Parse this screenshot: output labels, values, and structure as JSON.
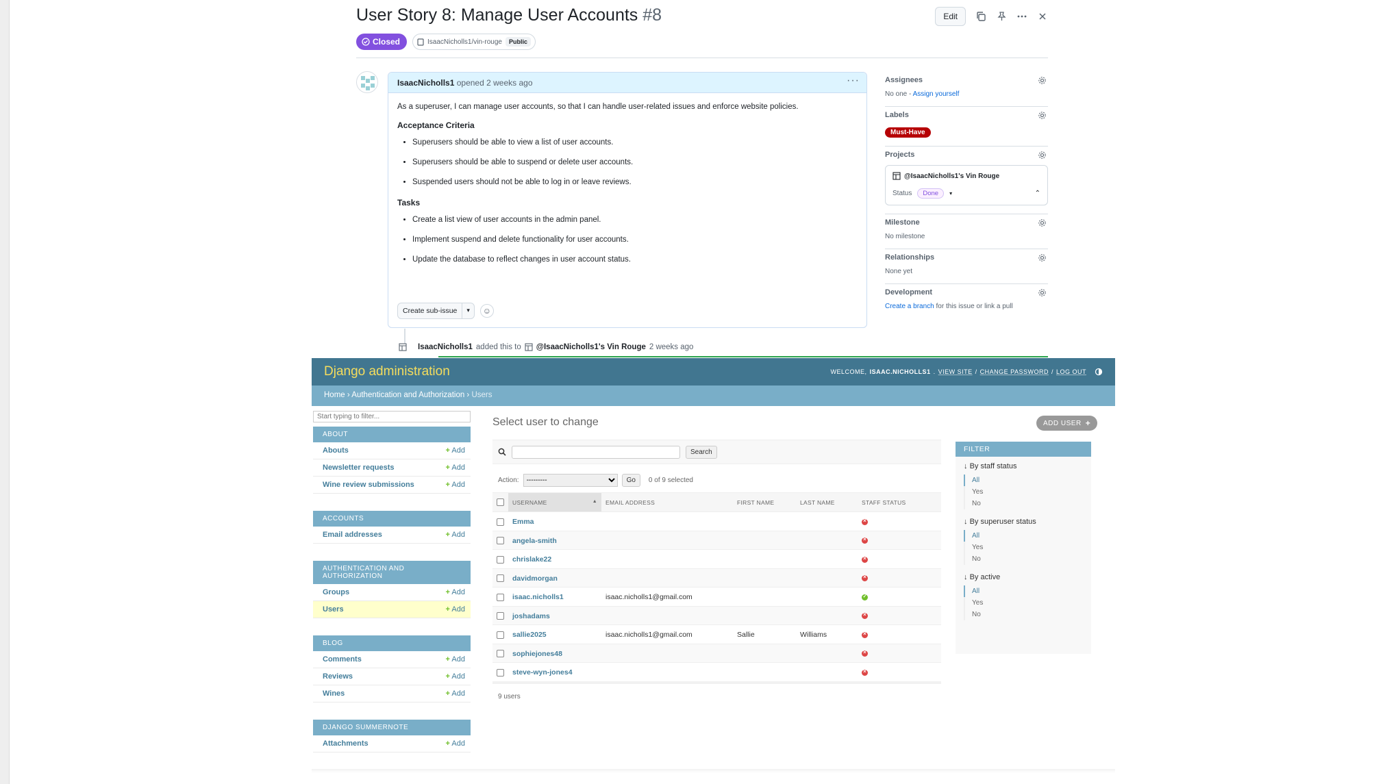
{
  "github": {
    "title": "User Story 8: Manage User Accounts",
    "number": "#8",
    "edit_label": "Edit",
    "status": "Closed",
    "repo": "IsaacNicholls1/vin-rouge",
    "visibility": "Public",
    "comment": {
      "author": "IsaacNicholls1",
      "meta": "opened 2 weeks ago",
      "intro": "As a superuser, I can manage user accounts, so that I can handle user-related issues and enforce website policies.",
      "criteria_heading": "Acceptance Criteria",
      "criteria": [
        "Superusers should be able to view a list of user accounts.",
        "Superusers should be able to suspend or delete user accounts.",
        "Suspended users should not be able to log in or leave reviews."
      ],
      "tasks_heading": "Tasks",
      "tasks": [
        "Create a list view of user accounts in the admin panel.",
        "Implement suspend and delete functionality for user accounts.",
        "Update the database to reflect changes in user account status."
      ],
      "sub_issue_label": "Create sub-issue"
    },
    "timeline": {
      "user": "IsaacNicholls1",
      "text": "added this to",
      "project": "@IsaacNicholls1's Vin Rouge",
      "time": "2 weeks ago"
    },
    "sidebar": {
      "assignees_title": "Assignees",
      "assignees_text": "No one -",
      "assign_link": "Assign yourself",
      "labels_title": "Labels",
      "label": "Must-Have",
      "projects_title": "Projects",
      "project_name": "@IsaacNicholls1's Vin Rouge",
      "status_label": "Status",
      "status_value": "Done",
      "milestone_title": "Milestone",
      "milestone_text": "No milestone",
      "relationships_title": "Relationships",
      "relationships_text": "None yet",
      "development_title": "Development",
      "development_link": "Create a branch",
      "development_text": "for this issue or link a pull"
    }
  },
  "django": {
    "brand": "Django administration",
    "welcome": "WELCOME,",
    "username": "ISAAC.NICHOLLS1",
    "links": [
      "VIEW SITE",
      "CHANGE PASSWORD",
      "LOG OUT"
    ],
    "breadcrumbs": [
      "Home",
      "Authentication and Authorization",
      "Users"
    ],
    "filter_placeholder": "Start typing to filter...",
    "add_label": "Add",
    "modules": [
      {
        "name": "ABOUT",
        "items": [
          "Abouts",
          "Newsletter requests",
          "Wine review submissions"
        ]
      },
      {
        "name": "ACCOUNTS",
        "items": [
          "Email addresses"
        ]
      },
      {
        "name": "AUTHENTICATION AND AUTHORIZATION",
        "items": [
          "Groups",
          "Users"
        ]
      },
      {
        "name": "BLOG",
        "items": [
          "Comments",
          "Reviews",
          "Wines"
        ]
      },
      {
        "name": "DJANGO SUMMERNOTE",
        "items": [
          "Attachments"
        ]
      }
    ],
    "page_title": "Select user to change",
    "add_user": "ADD USER",
    "search_button": "Search",
    "action_label": "Action:",
    "action_value": "---------",
    "go_label": "Go",
    "selected_text": "0 of 9 selected",
    "columns": [
      "USERNAME",
      "EMAIL ADDRESS",
      "FIRST NAME",
      "LAST NAME",
      "STAFF STATUS"
    ],
    "rows": [
      {
        "username": "Emma",
        "email": "",
        "first": "",
        "last": "",
        "staff": false
      },
      {
        "username": "angela-smith",
        "email": "",
        "first": "",
        "last": "",
        "staff": false
      },
      {
        "username": "chrislake22",
        "email": "",
        "first": "",
        "last": "",
        "staff": false
      },
      {
        "username": "davidmorgan",
        "email": "",
        "first": "",
        "last": "",
        "staff": false
      },
      {
        "username": "isaac.nicholls1",
        "email": "isaac.nicholls1@gmail.com",
        "first": "",
        "last": "",
        "staff": true
      },
      {
        "username": "joshadams",
        "email": "",
        "first": "",
        "last": "",
        "staff": false
      },
      {
        "username": "sallie2025",
        "email": "isaac.nicholls1@gmail.com",
        "first": "Sallie",
        "last": "Williams",
        "staff": false
      },
      {
        "username": "sophiejones48",
        "email": "",
        "first": "",
        "last": "",
        "staff": false
      },
      {
        "username": "steve-wyn-jones4",
        "email": "",
        "first": "",
        "last": "",
        "staff": false
      }
    ],
    "paginator": "9 users",
    "filter": {
      "title": "FILTER",
      "sections": [
        {
          "title": "By staff status",
          "options": [
            "All",
            "Yes",
            "No"
          ]
        },
        {
          "title": "By superuser status",
          "options": [
            "All",
            "Yes",
            "No"
          ]
        },
        {
          "title": "By active",
          "options": [
            "All",
            "Yes",
            "No"
          ]
        }
      ]
    }
  }
}
